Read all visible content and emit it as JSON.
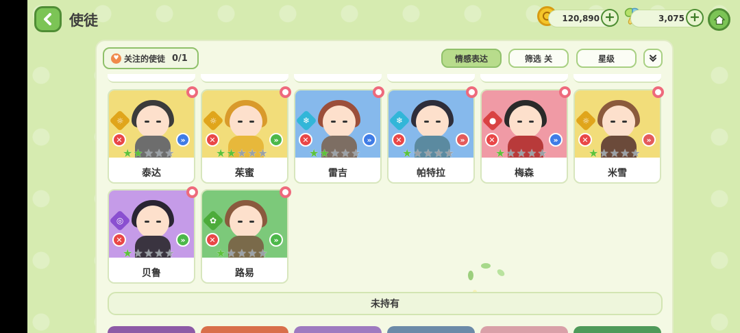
{
  "header": {
    "title": "使徒",
    "coins": "120,890",
    "gems": "3,075"
  },
  "toolbar": {
    "follow_label": "关注的使徒",
    "follow_count": "0/1",
    "tab_emotion": "情感表达",
    "tab_filter": "筛选 关",
    "tab_stars": "星级"
  },
  "owned": [
    {
      "name": "泰达",
      "stars": 2,
      "element": "☼",
      "element_color": "#e0a51b",
      "rank_color": "#3f7ce6",
      "art_bg": "#f2dd7a",
      "hair": "#3b3b3b",
      "outfit": "#6d6d6d"
    },
    {
      "name": "茱蜜",
      "stars": 2,
      "element": "☼",
      "element_color": "#e0a51b",
      "rank_color": "#4cb84a",
      "art_bg": "#f2dd7a",
      "hair": "#d99a2b",
      "outfit": "#e7b83b"
    },
    {
      "name": "雷吉",
      "stars": 2,
      "element": "❄",
      "element_color": "#32b6d8",
      "rank_color": "#3f7ce6",
      "art_bg": "#86b9ec",
      "hair": "#9b4e3a",
      "outfit": "#7d6e63"
    },
    {
      "name": "帕特拉",
      "stars": 1,
      "element": "❄",
      "element_color": "#32b6d8",
      "rank_color": "#e45b5b",
      "art_bg": "#86b9ec",
      "hair": "#2e2e3a",
      "outfit": "#5b8aa0"
    },
    {
      "name": "梅森",
      "stars": 1,
      "element": "●",
      "element_color": "#d94242",
      "rank_color": "#3f7ce6",
      "art_bg": "#f09aa5",
      "hair": "#2a2a2a",
      "outfit": "#b83a3a"
    },
    {
      "name": "米雪",
      "stars": 1,
      "element": "☼",
      "element_color": "#e0a51b",
      "rank_color": "#e45b5b",
      "art_bg": "#f2dd7a",
      "hair": "#8b5a3c",
      "outfit": "#6b4a3a"
    },
    {
      "name": "贝鲁",
      "stars": 1,
      "element": "◎",
      "element_color": "#8a4fd0",
      "rank_color": "#4cb84a",
      "art_bg": "#c59be8",
      "hair": "#2a2533",
      "outfit": "#3a3440"
    },
    {
      "name": "路易",
      "stars": 1,
      "element": "✿",
      "element_color": "#4cab3a",
      "rank_color": "#4cb84a",
      "art_bg": "#7cc97a",
      "hair": "#8a5a3e",
      "outfit": "#7a6a4a"
    }
  ],
  "not_owned_label": "未持有",
  "bottom_stub_colors": [
    "#8d5aa6",
    "#d96f4a",
    "#9e7ac0",
    "#6c8aa8",
    "#d9a0a8",
    "#4f9a5a"
  ],
  "colors": {
    "accent_green": "#7cc456",
    "background": "#d6ebb0",
    "panel": "#f4f9e4",
    "star_on": "#5cc23b",
    "star_off": "#9aa1a7"
  },
  "icons": {
    "back": "chevron-left-icon",
    "coin": "coin-icon",
    "gem": "gem-icon",
    "home": "home-icon",
    "heart": "heart-icon",
    "collapse": "double-chevron-down-icon",
    "favorite": "flower-icon"
  }
}
